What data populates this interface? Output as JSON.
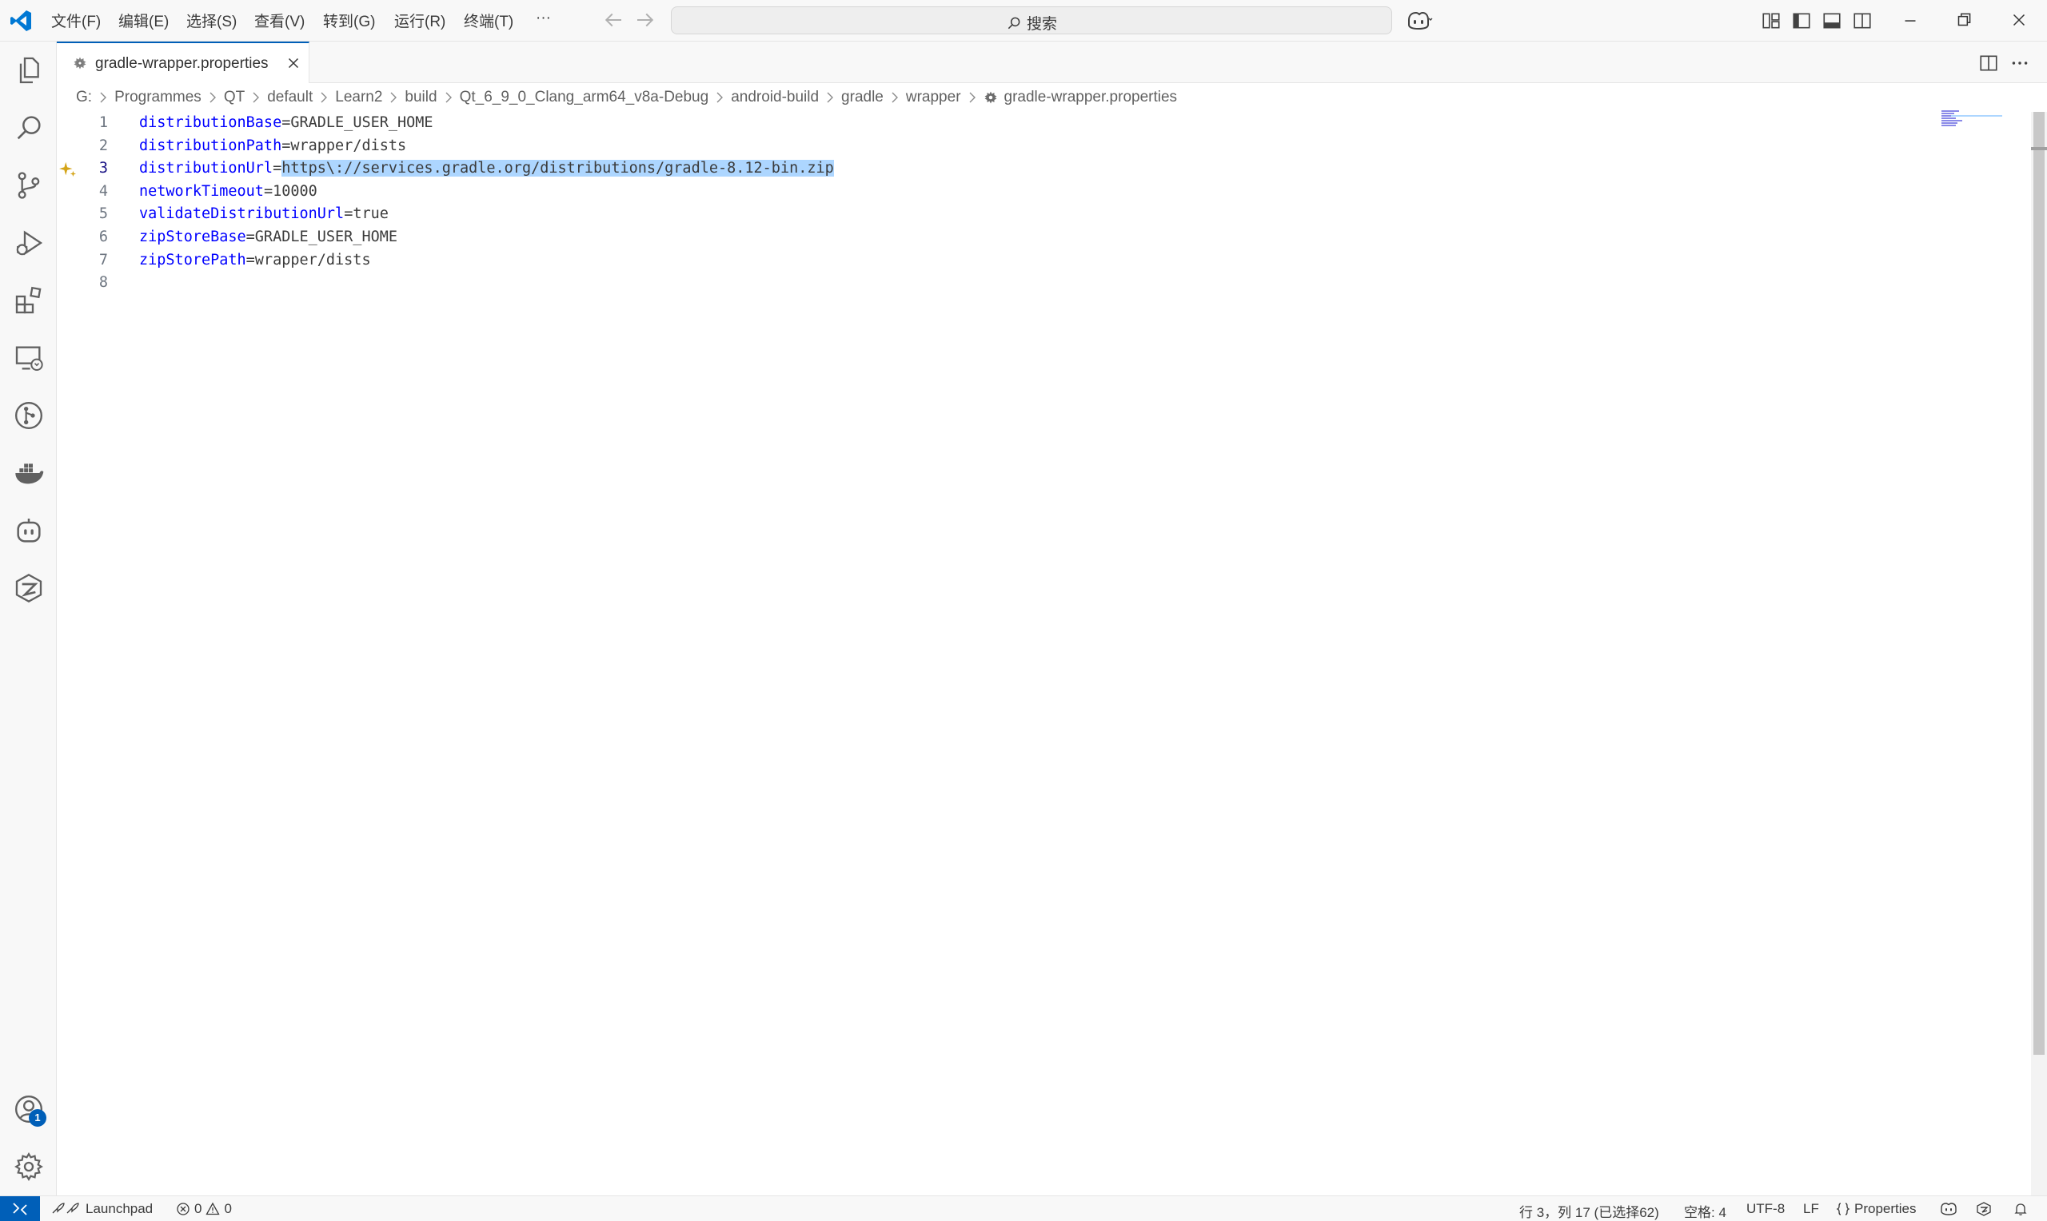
{
  "menu": {
    "file": "文件(F)",
    "edit": "编辑(E)",
    "selection": "选择(S)",
    "view": "查看(V)",
    "goto": "转到(G)",
    "run": "运行(R)",
    "terminal": "终端(T)",
    "more": "···"
  },
  "search": {
    "placeholder": "搜索"
  },
  "tab": {
    "label": "gradle-wrapper.properties"
  },
  "breadcrumb": [
    "G:",
    "Programmes",
    "QT",
    "default",
    "Learn2",
    "build",
    "Qt_6_9_0_Clang_arm64_v8a-Debug",
    "android-build",
    "gradle",
    "wrapper",
    "gradle-wrapper.properties"
  ],
  "editor": {
    "lines": [
      {
        "num": "1",
        "key": "distributionBase",
        "value": "=GRADLE_USER_HOME"
      },
      {
        "num": "2",
        "key": "distributionPath",
        "value": "=wrapper/dists"
      },
      {
        "num": "3",
        "key": "distributionUrl",
        "eq": "=",
        "selected": "https\\://services.gradle.org/distributions/gradle-8.12-bin.zip"
      },
      {
        "num": "4",
        "key": "networkTimeout",
        "value": "=10000"
      },
      {
        "num": "5",
        "key": "validateDistributionUrl",
        "value": "=true"
      },
      {
        "num": "6",
        "key": "zipStoreBase",
        "value": "=GRADLE_USER_HOME"
      },
      {
        "num": "7",
        "key": "zipStorePath",
        "value": "=wrapper/dists"
      },
      {
        "num": "8",
        "key": "",
        "value": ""
      }
    ]
  },
  "accounts": {
    "badge": "1"
  },
  "statusbar": {
    "launchpad": "Launchpad",
    "errors": "0",
    "warnings": "0",
    "position": "行 3，列 17 (已选择62)",
    "spaces": "空格: 4",
    "encoding": "UTF-8",
    "eol": "LF",
    "language": "Properties"
  },
  "colors": {
    "accent": "#005fb8",
    "keyword": "#0000ff",
    "selection": "#add6ff",
    "sparkle": "#d4a417"
  },
  "icons": [
    "vscode-logo",
    "arrow-left-icon",
    "arrow-right-icon",
    "search-icon",
    "copilot-icon",
    "layout-icon",
    "files-icon",
    "source-control-icon",
    "run-debug-icon",
    "extensions-icon",
    "remote-explorer-icon",
    "gitlens-icon",
    "docker-icon",
    "copilot-chat-icon",
    "qt-icon",
    "accounts-icon",
    "settings-gear-icon",
    "close-icon",
    "split-editor-icon",
    "more-icon",
    "bell-icon"
  ]
}
